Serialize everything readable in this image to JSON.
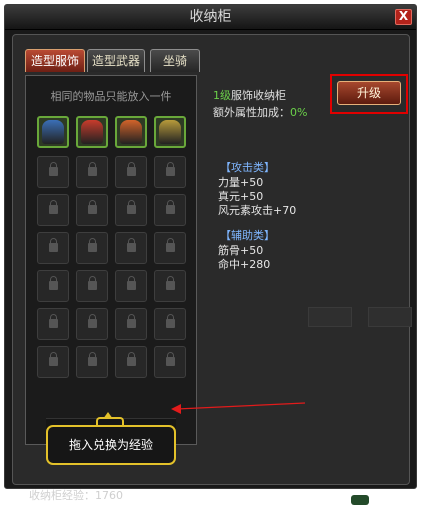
{
  "window": {
    "title": "收纳柜",
    "close_label": "X"
  },
  "tabs": [
    {
      "label": "造型服饰",
      "active": true
    },
    {
      "label": "造型武器",
      "active": false
    },
    {
      "label": "坐骑",
      "active": false
    }
  ],
  "inventory": {
    "hint": "相同的物品只能放入一件",
    "items": [
      {
        "icon": "blue-armor-icon",
        "color": "#3b6fb7"
      },
      {
        "icon": "red-white-robe-icon",
        "color": "#c83c2c"
      },
      {
        "icon": "flame-outfit-icon",
        "color": "#d2632a"
      },
      {
        "icon": "gold-green-armor-icon",
        "color": "#b79b3b"
      }
    ],
    "locked_rows": 6,
    "columns": 4
  },
  "cabinet": {
    "level_number": "1级",
    "level_text": "服饰收纳柜",
    "bonus_label": "额外属性加成：",
    "bonus_value": "0%",
    "upgrade_label": "升级"
  },
  "attributes": {
    "attack_header": "【攻击类】",
    "attack": [
      "力量+50",
      "真元+50",
      "风元素攻击+70"
    ],
    "support_header": "【辅助类】",
    "support": [
      "筋骨+50",
      "命中+280"
    ]
  },
  "tooltip": {
    "text": "拖入兑换为经验"
  },
  "footer": {
    "exp_label": "收纳柜经验：",
    "exp_value": "1760"
  },
  "colors": {
    "green": "#6bd14a",
    "accent_red": "#e10000",
    "tooltip_border": "#e3c12a",
    "header_blue": "#7fb6ff"
  }
}
